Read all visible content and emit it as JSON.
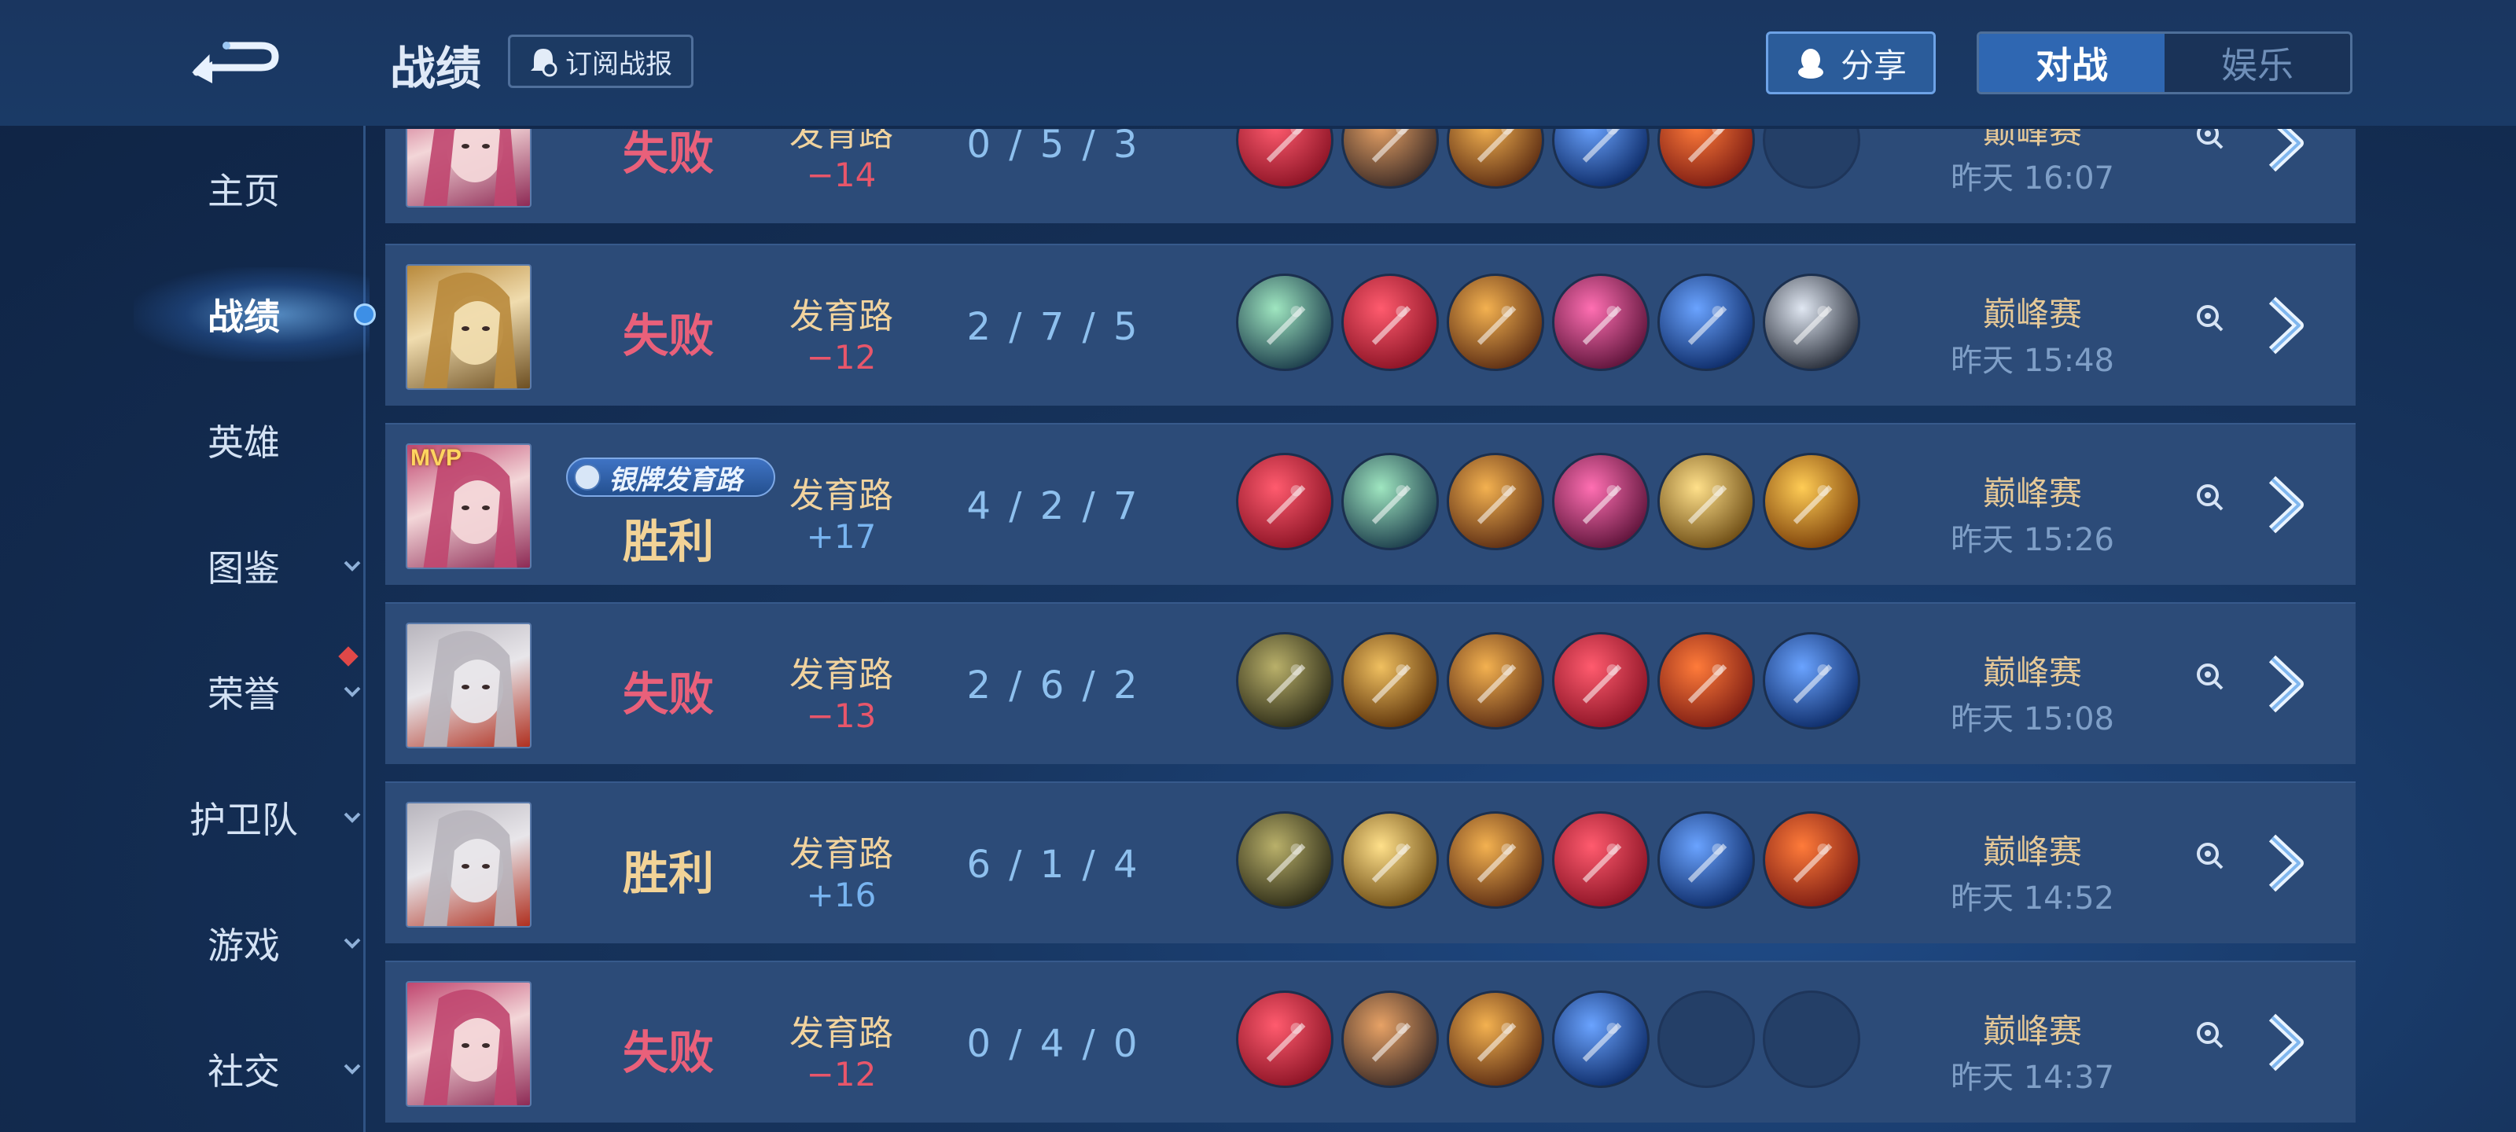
{
  "header": {
    "title": "战绩",
    "subscribe_label": "订阅战报",
    "share_label": "分享",
    "tabs": [
      {
        "label": "对战",
        "active": true
      },
      {
        "label": "娱乐",
        "active": false
      }
    ]
  },
  "sidebar": {
    "items": [
      {
        "label": "主页",
        "active": false,
        "has_chevron": false
      },
      {
        "label": "战绩",
        "active": true,
        "has_chevron": false
      },
      {
        "label": "英雄",
        "active": false,
        "has_chevron": false
      },
      {
        "label": "图鉴",
        "active": false,
        "has_chevron": true
      },
      {
        "label": "荣誉",
        "active": false,
        "has_chevron": true,
        "notification": true
      },
      {
        "label": "护卫队",
        "active": false,
        "has_chevron": true
      },
      {
        "label": "游戏",
        "active": false,
        "has_chevron": true
      },
      {
        "label": "社交",
        "active": false,
        "has_chevron": true
      }
    ]
  },
  "matches": [
    {
      "hero": "pink-hair-hero",
      "mvp": false,
      "badge": "",
      "result": "失败",
      "win": false,
      "lane": "发育路",
      "score": "−14",
      "kda": "0 / 5 / 3",
      "items": [
        "red-mask",
        "bronze-boots",
        "orange-blade",
        "blue-spear",
        "red-axe",
        "empty"
      ],
      "mode": "巅峰赛",
      "time": "昨天 16:07"
    },
    {
      "hero": "gold-armor-hero",
      "mvp": false,
      "badge": "",
      "result": "失败",
      "win": false,
      "lane": "发育路",
      "score": "−12",
      "kda": "2 / 7 / 5",
      "items": [
        "green-boots",
        "red-mask",
        "orange-blade",
        "pink-bow",
        "blue-spear",
        "silver-blade"
      ],
      "mode": "巅峰赛",
      "time": "昨天 15:48"
    },
    {
      "hero": "pink-hair-hero",
      "mvp": true,
      "mvp_label": "MVP",
      "badge": "银牌发育路",
      "result": "胜利",
      "win": true,
      "lane": "发育路",
      "score": "+17",
      "kda": "4 / 2 / 7",
      "items": [
        "red-mask",
        "green-boots",
        "orange-blade",
        "pink-bow",
        "gold-sword",
        "gold-star"
      ],
      "mode": "巅峰赛",
      "time": "昨天 15:26"
    },
    {
      "hero": "silver-hair-hero",
      "mvp": false,
      "badge": "",
      "result": "失败",
      "win": false,
      "lane": "发育路",
      "score": "−13",
      "kda": "2 / 6 / 2",
      "items": [
        "olive-boots",
        "gold-crescent",
        "orange-blade",
        "red-mask",
        "red-axe",
        "blue-spear"
      ],
      "mode": "巅峰赛",
      "time": "昨天 15:08"
    },
    {
      "hero": "silver-hair-hero",
      "mvp": false,
      "badge": "",
      "result": "胜利",
      "win": true,
      "lane": "发育路",
      "score": "+16",
      "kda": "6 / 1 / 4",
      "items": [
        "olive-boots",
        "gold-sword",
        "orange-blade",
        "red-mask",
        "blue-spear",
        "red-axe"
      ],
      "mode": "巅峰赛",
      "time": "昨天 14:52"
    },
    {
      "hero": "pink-hair-hero",
      "mvp": false,
      "badge": "",
      "result": "失败",
      "win": false,
      "lane": "发育路",
      "score": "−12",
      "kda": "0 / 4 / 0",
      "items": [
        "red-mask",
        "bronze-boots",
        "orange-blade",
        "blue-spear",
        "empty",
        "empty"
      ],
      "mode": "巅峰赛",
      "time": "昨天 14:37"
    }
  ],
  "colors": {
    "lose": "#e9607a",
    "win": "#f2d397",
    "score_negative": "#e8566a",
    "score_positive": "#78b4f0",
    "accent": "#2f67b2"
  }
}
